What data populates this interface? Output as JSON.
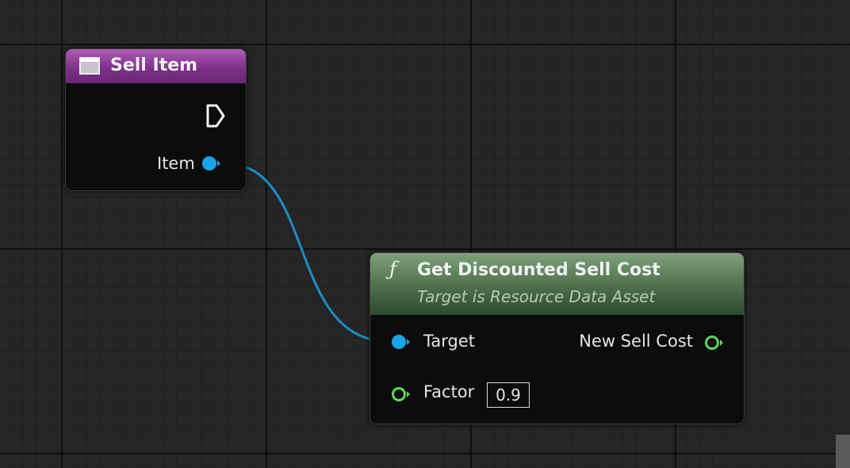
{
  "nodes": {
    "sell_item": {
      "title": "Sell Item",
      "pins": {
        "item_label": "Item"
      }
    },
    "get_discounted_sell_cost": {
      "icon": "ƒ",
      "title": "Get Discounted Sell Cost",
      "subtitle": "Target is Resource Data Asset",
      "pins": {
        "target_label": "Target",
        "output_label": "New Sell Cost",
        "factor_label": "Factor",
        "factor_value": "0.9"
      }
    }
  },
  "colors": {
    "event_header": "#7a2f86",
    "function_header": "#4d6f4b",
    "object_pin": "#1aa3e8",
    "float_pin": "#5fd85a",
    "wire": "#1a8fc4"
  },
  "icons": [
    "event-node-icon",
    "function-icon",
    "exec-pin-icon",
    "object-pin-icon",
    "float-pin-icon"
  ]
}
